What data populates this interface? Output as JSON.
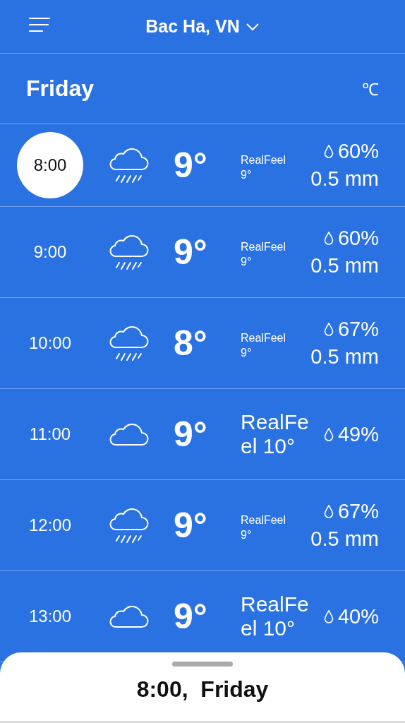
{
  "header": {
    "location": "Bac Ha, VN"
  },
  "day": {
    "title": "Friday",
    "unit": "℃"
  },
  "hours": [
    {
      "time": "8:00",
      "selected": true,
      "kind": "rain",
      "temp": "9°",
      "realfeel": "RealFeel 9°",
      "realfeel_large": false,
      "chance": "60%",
      "amount": "0.5 mm"
    },
    {
      "time": "9:00",
      "selected": false,
      "kind": "rain",
      "temp": "9°",
      "realfeel": "RealFeel 9°",
      "realfeel_large": false,
      "chance": "60%",
      "amount": "0.5 mm"
    },
    {
      "time": "10:00",
      "selected": false,
      "kind": "rain",
      "temp": "8°",
      "realfeel": "RealFeel 9°",
      "realfeel_large": false,
      "chance": "67%",
      "amount": "0.5 mm"
    },
    {
      "time": "11:00",
      "selected": false,
      "kind": "cloud",
      "temp": "9°",
      "realfeel": "RealFeel 10°",
      "realfeel_large": true,
      "chance": "49%"
    },
    {
      "time": "12:00",
      "selected": false,
      "kind": "rain",
      "temp": "9°",
      "realfeel": "RealFeel 9°",
      "realfeel_large": false,
      "chance": "67%",
      "amount": "0.5 mm"
    },
    {
      "time": "13:00",
      "selected": false,
      "kind": "cloud",
      "temp": "9°",
      "realfeel": "RealFeel 10°",
      "realfeel_large": true,
      "chance": "40%"
    }
  ],
  "sheet": {
    "title": "8:00,  Friday"
  }
}
